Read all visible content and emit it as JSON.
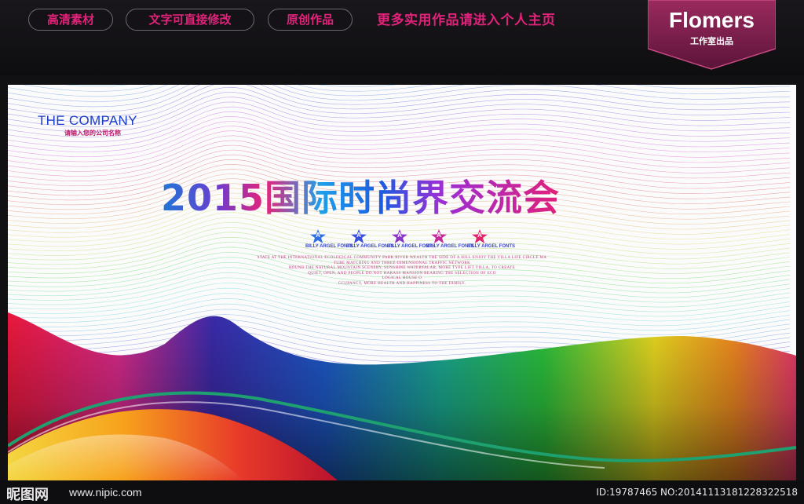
{
  "topbar": {
    "tags": [
      "高清素材",
      "文字可直接修改",
      "原创作品"
    ],
    "promo": "更多实用作品请进入个人主页",
    "brand_name": "Flomers",
    "brand_sub": "工作室出品",
    "accent_color": "#e0227a"
  },
  "poster": {
    "company": "THE COMPANY",
    "company_sub": "请输入您的公司名称",
    "headline": "2015国际时尚界交流会",
    "star_letter": "A",
    "star_label": "BILLY ARGEL FONTS",
    "star_colors": [
      "#2f6fe0",
      "#3b4fd8",
      "#8a35c8",
      "#c42a9a",
      "#e0226a"
    ],
    "blurb": [
      "STATE AT THE INTERNATIONAL ECOLOGICAL COMMUNITY PARK RIVER WEALTH THE SIDE OF A HILL ENJOY THE VILLA LIFE CIRCLE MA",
      "TURE MATCHING AND THREE-DIMENSIONAL TRAFFIC NETWORK",
      "ROUND THE NATURAL MOUNTAIN SCENERY, SUNSHINE WATERFALAR, MORE TYPE LIFT VILLA, TO CREATE",
      "QUIET, OPEN, AND PEOPLE DO NOT HARASS MANSION BEARING THE SELECTION OF ECO",
      "LOGICAL HOUSE O",
      "CCUPANCY, MORE HEALTH AND HAPPINESS TO THE FAMILY."
    ]
  },
  "footer": {
    "logo": "昵图网",
    "site": "www.nipic.com",
    "id": "ID:19787465 NO:20141113181228322518"
  }
}
